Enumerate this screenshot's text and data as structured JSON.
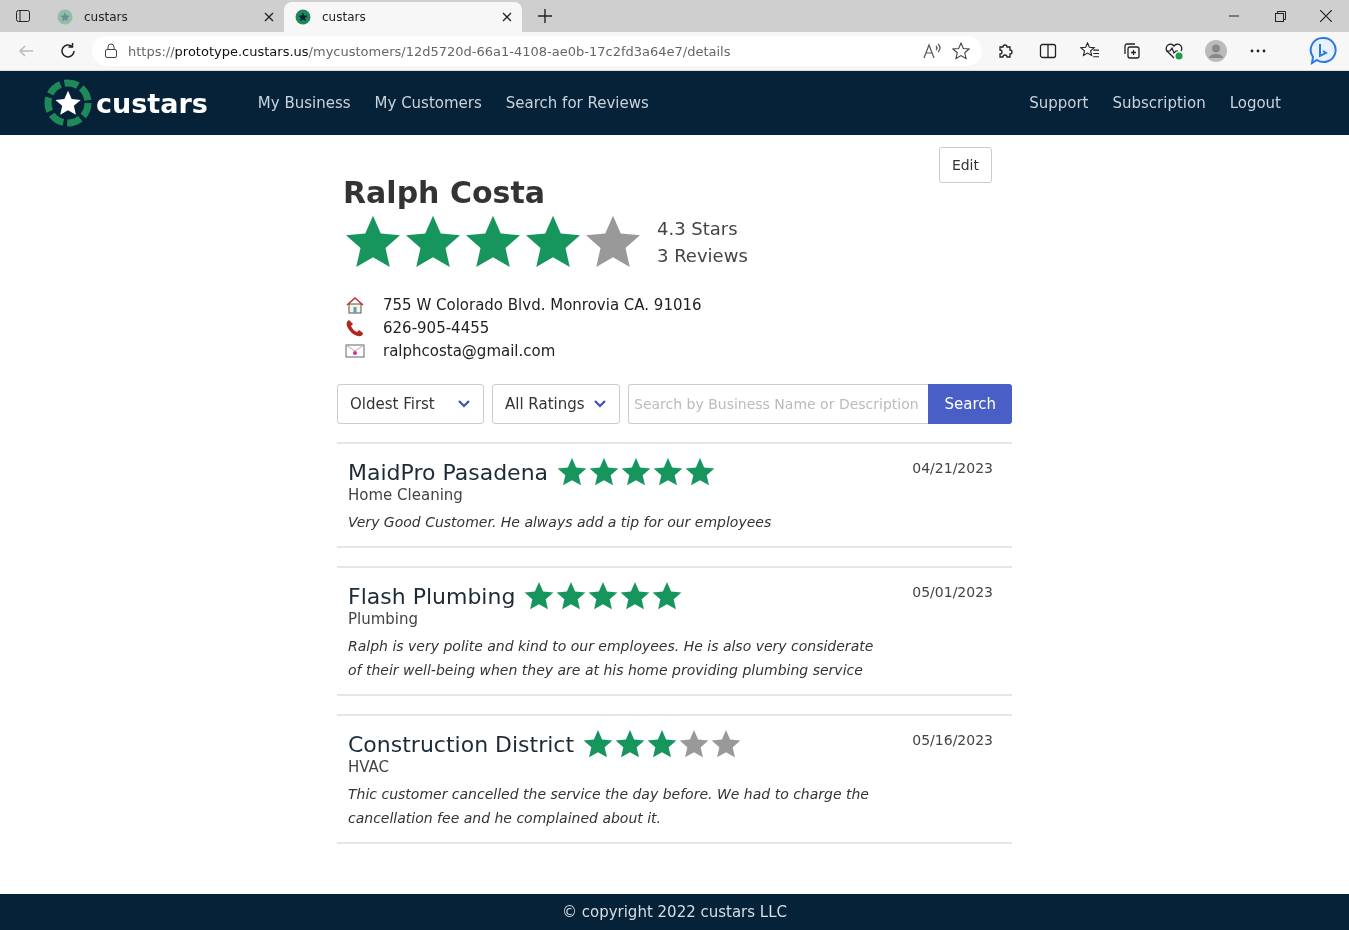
{
  "browser": {
    "tabs": [
      {
        "title": "custars",
        "selected": false
      },
      {
        "title": "custars",
        "selected": true
      }
    ],
    "url": {
      "scheme": "https://",
      "host": "prototype.custars.us",
      "path": "/mycustomers/12d5720d-66a1-4108-ae0b-17c2fd3a64e7/details"
    }
  },
  "nav": {
    "logo": "custars",
    "links": [
      "My Business",
      "My Customers",
      "Search for Reviews"
    ],
    "right_links": [
      "Support",
      "Subscription",
      "Logout"
    ]
  },
  "customer": {
    "edit_button": "Edit",
    "name": "Ralph Costa",
    "stars": 4,
    "rating": "4.3 Stars",
    "review_count": "3 Reviews",
    "address": "755 W Colorado Blvd. Monrovia CA. 91016",
    "phone": "626-905-4455",
    "email": "ralphcosta@gmail.com"
  },
  "filters": {
    "sort": "Oldest First",
    "ratings": "All Ratings",
    "search": {
      "placeholder": "Search by Business Name or Description"
    },
    "search_button": "Search"
  },
  "reviews": [
    {
      "business": "MaidPro Pasadena",
      "stars": 5,
      "category": "Home Cleaning",
      "date": "04/21/2023",
      "text": "Very Good Customer. He always add a tip for our employees"
    },
    {
      "business": "Flash Plumbing",
      "stars": 5,
      "category": "Plumbing",
      "date": "05/01/2023",
      "text": "Ralph is very polite and kind to our employees. He is also very considerate of their well-being when they are at his home providing plumbing service"
    },
    {
      "business": "Construction District",
      "stars": 3,
      "category": "HVAC",
      "date": "05/16/2023",
      "text": "Thic customer cancelled the service the day before. We had to charge the cancellation fee and he complained about it."
    }
  ],
  "footer": "© copyright 2022 custars LLC"
}
